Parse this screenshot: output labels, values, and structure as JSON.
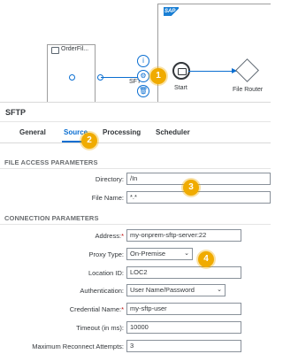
{
  "canvas": {
    "sap_logo": "SAP",
    "sender_title": "OrderFil...",
    "edge_label": "SFT",
    "start_label": "Start",
    "router_label": "File Router",
    "context_buttons": [
      "info-icon",
      "gear-icon",
      "delete-icon"
    ]
  },
  "panel": {
    "title": "SFTP",
    "tabs": [
      {
        "label": "General"
      },
      {
        "label": "Source"
      },
      {
        "label": "Processing"
      },
      {
        "label": "Scheduler"
      }
    ]
  },
  "file_access": {
    "heading": "FILE ACCESS PARAMETERS",
    "directory_label": "Directory:",
    "directory_value": "/In",
    "file_name_label": "File Name:",
    "file_name_value": "*.*"
  },
  "connection": {
    "heading": "CONNECTION PARAMETERS",
    "address_label": "Address:",
    "address_required": "*",
    "address_value": "my-onprem-sftp-server:22",
    "proxy_label": "Proxy Type:",
    "proxy_value": "On-Premise",
    "location_label": "Location ID:",
    "location_value": "LOC2",
    "auth_label": "Authentication:",
    "auth_value": "User Name/Password",
    "credential_label": "Credential Name:",
    "credential_required": "*",
    "credential_value": "my-sftp-user",
    "timeout_label": "Timeout (in ms):",
    "timeout_value": "10000",
    "reconnect_label": "Maximum Reconnect Attempts:",
    "reconnect_value": "3"
  },
  "badges": [
    "1",
    "2",
    "3",
    "4"
  ],
  "colors": {
    "accent": "#0a6ed1",
    "badge": "#f0ab00",
    "required": "#bb0000"
  }
}
